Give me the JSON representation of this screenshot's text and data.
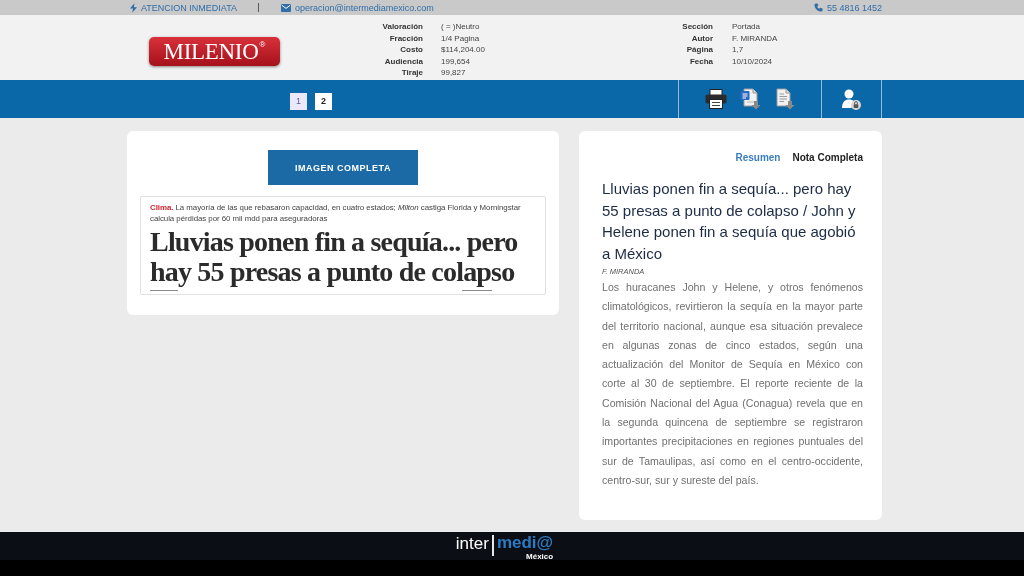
{
  "top_bar": {
    "items": [
      {
        "kind": "urgent",
        "text": "ATENCION INMEDIATA"
      },
      {
        "kind": "email",
        "text": "operacion@intermediamexico.com"
      },
      {
        "kind": "phone",
        "text": "55 4816 1452"
      }
    ]
  },
  "header": {
    "logo": {
      "text": "MILENIO",
      "mark": "®"
    },
    "details_left": [
      {
        "label": "Valoración",
        "value": "( = )Neutro"
      },
      {
        "label": "Fracción",
        "value": "1/4 Pagina"
      },
      {
        "label": "Costo",
        "value": "$114,204.00"
      },
      {
        "label": "Audiencia",
        "value": "199,654"
      },
      {
        "label": "Tiraje",
        "value": "99,827"
      }
    ],
    "details_right": [
      {
        "label": "Sección",
        "value": "Portada"
      },
      {
        "label": "Autor",
        "value": "F. MIRANDA"
      },
      {
        "label": "Página",
        "value": "1,7"
      },
      {
        "label": "Fecha",
        "value": "10/10/2024"
      }
    ]
  },
  "toolbar": {
    "pages": [
      {
        "label": "1",
        "selected": true
      },
      {
        "label": "2",
        "selected": false
      }
    ]
  },
  "clipping": {
    "button": "IMAGEN COMPLETA",
    "deck": "**Clima.** La mayoría de las que rebasaron capacidad, en cuatro estados; *Milton* castiga Florida y Morningstar calcula pérdidas por 60 mil mdd para aseguradoras",
    "headline": "Lluvias ponen fin a sequía... pero hay 55 presas a punto de colapso"
  },
  "article": {
    "tabs": [
      {
        "label": "Resumen",
        "selected": true
      },
      {
        "label": "Nota Completa",
        "selected": false
      }
    ],
    "title": "Lluvias ponen fin a sequía... pero hay 55 presas a punto de colapso / John y Helene ponen fin a sequía que agobió a México",
    "author": "F. MIRANDA",
    "body": "Los huracanes John y Helene, y otros fenómenos climatológicos, revirtieron la sequía en la mayor parte del territorio nacional, aunque esa situación prevalece en algunas zonas de cinco estados, según una actualización del Monitor de Sequía en México con corte al 30 de septiembre. El reporte reciente de la Comisión Nacional del Agua (Conagua) revela que en la segunda quincena de septiembre se registraron importantes precipitaciones en regiones puntuales del sur de Tamaulipas, así como en el centro-occidente, centro-sur, sur y sureste del país."
  },
  "footer": {
    "logo": {
      "left": "inter",
      "right": "medi@",
      "subtitle": "México"
    }
  }
}
